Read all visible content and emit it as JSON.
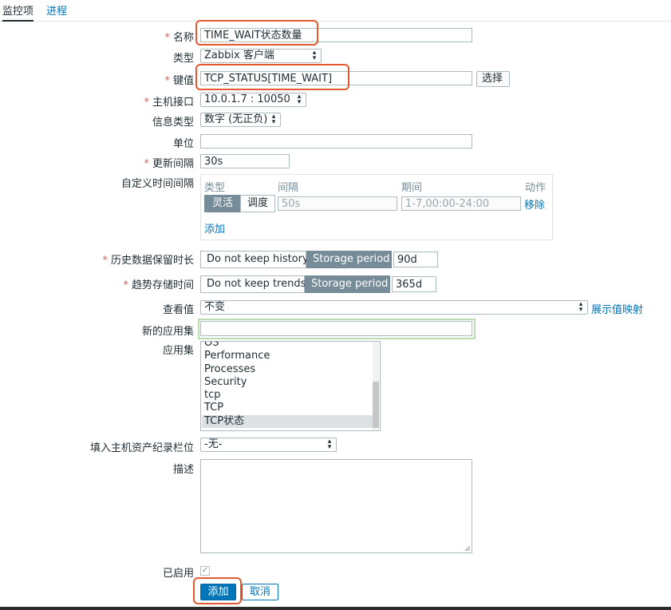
{
  "tabs": {
    "items_tab": "监控项",
    "process_tab": "进程"
  },
  "form": {
    "name": {
      "label": "名称",
      "value": "TIME_WAIT状态数量"
    },
    "type": {
      "label": "类型",
      "value": "Zabbix 客户端"
    },
    "key": {
      "label": "键值",
      "value": "TCP_STATUS[TIME_WAIT]",
      "select_button": "选择"
    },
    "host_interface": {
      "label": "主机接口",
      "value": "10.0.1.7 : 10050"
    },
    "info_type": {
      "label": "信息类型",
      "value": "数字 (无正负)"
    },
    "units": {
      "label": "单位",
      "value": ""
    },
    "update_interval": {
      "label": "更新间隔",
      "value": "30s"
    },
    "custom_intervals": {
      "label": "自定义时间间隔",
      "headers": {
        "type": "类型",
        "interval": "间隔",
        "period": "期间",
        "action": "动作"
      },
      "row": {
        "flexible": "灵活",
        "scheduling": "调度",
        "interval_value": "50s",
        "period_value": "1-7,00:00-24:00",
        "remove": "移除"
      },
      "add_link": "添加"
    },
    "history": {
      "label": "历史数据保留时长",
      "no_keep": "Do not keep history",
      "storage": "Storage period",
      "value": "90d"
    },
    "trends": {
      "label": "趋势存储时间",
      "no_keep": "Do not keep trends",
      "storage": "Storage period",
      "value": "365d"
    },
    "show_value": {
      "label": "查看值",
      "value": "不变",
      "link": "展示值映射"
    },
    "new_application": {
      "label": "新的应用集",
      "value": ""
    },
    "applications": {
      "label": "应用集",
      "items": [
        "OS",
        "Performance",
        "Processes",
        "Security",
        "tcp",
        "TCP",
        "TCP状态"
      ],
      "selected": "TCP状态"
    },
    "inventory": {
      "label": "填入主机资产纪录栏位",
      "value": "-无-"
    },
    "description": {
      "label": "描述",
      "value": ""
    },
    "enabled": {
      "label": "已启用",
      "checked": true
    },
    "buttons": {
      "add": "添加",
      "cancel": "取消"
    }
  },
  "colors": {
    "accent": "#0275b8",
    "highlight_box": "#e25a2d",
    "focus_box": "#b9dcb1",
    "toggle_active": "#768d99",
    "required": "#e45959"
  }
}
